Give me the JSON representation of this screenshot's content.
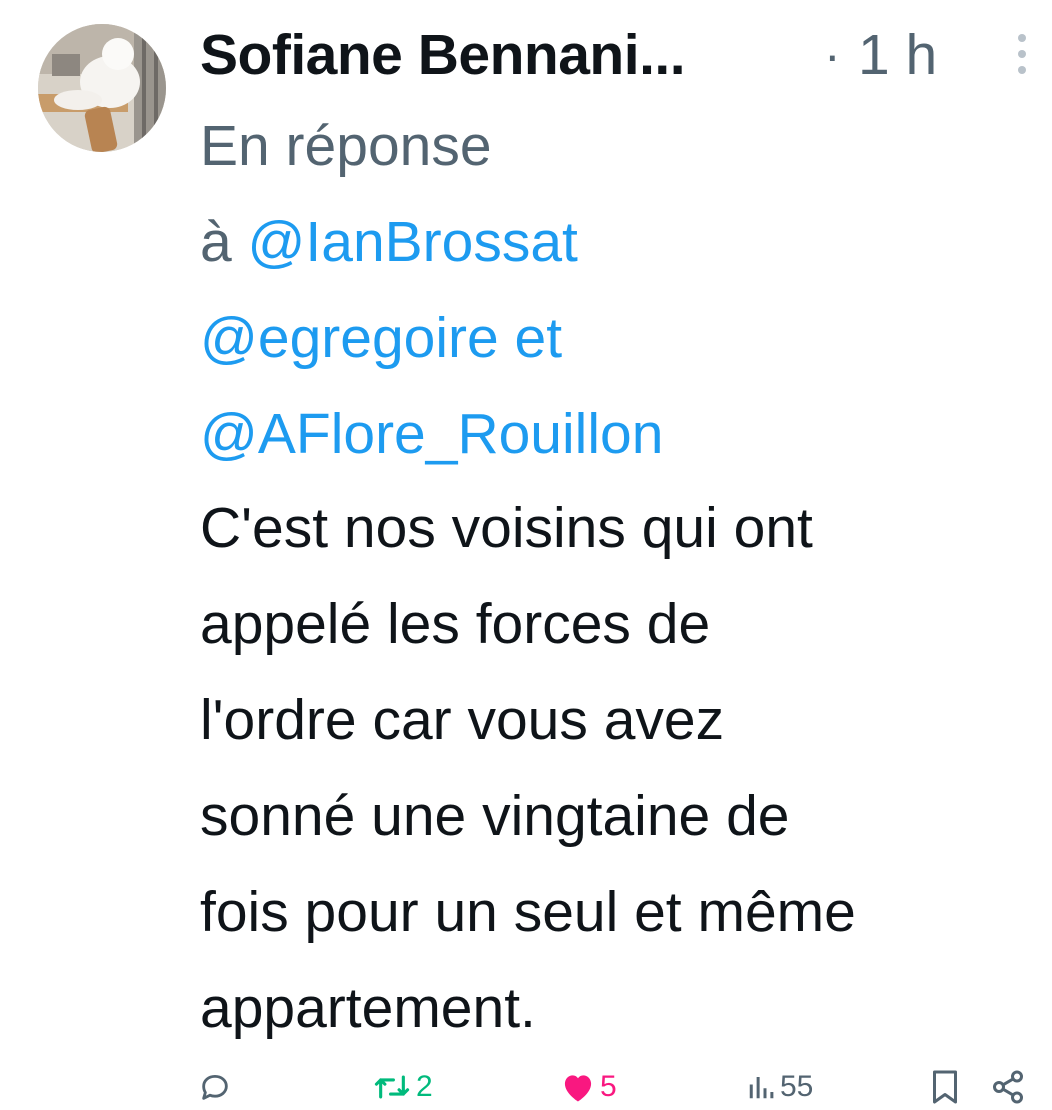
{
  "tweet": {
    "author_name": "Sofiane Bennani...",
    "separator": "·",
    "time": "1 h",
    "reply_prefix": "En réponse",
    "reply_a": "à",
    "reply_and": "et",
    "mentions": [
      "@IanBrossat",
      "@egregoire",
      "@AFlore_Rouillon"
    ],
    "text_lines": [
      "C'est nos voisins qui ont",
      "appelé les forces de",
      "l'ordre car vous avez",
      "sonné une vingtaine de",
      "fois pour un seul et même",
      "appartement."
    ]
  },
  "actions": {
    "retweets": "2",
    "likes": "5",
    "views": "55"
  },
  "colors": {
    "text": "#0f1419",
    "muted": "#536471",
    "link": "#1d9bf0",
    "retweet": "#00ba7c",
    "like": "#f91880"
  },
  "icons": [
    "more-vertical-icon",
    "reply-icon",
    "retweet-icon",
    "like-heart-icon",
    "views-icon",
    "bookmark-icon",
    "share-icon"
  ]
}
